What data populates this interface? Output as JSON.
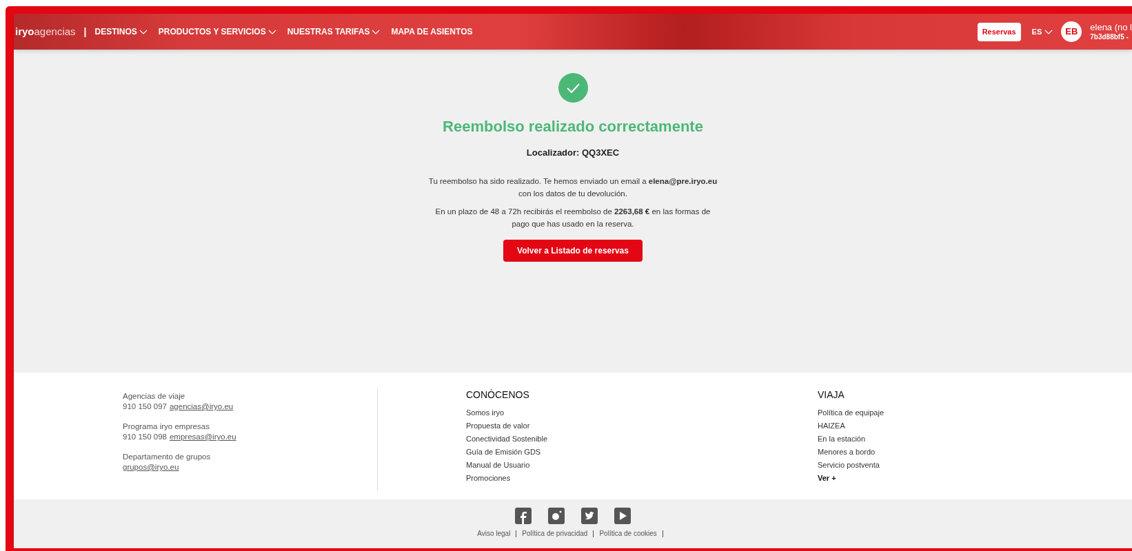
{
  "header": {
    "logo_bold": "iryo",
    "logo_light": "agencias",
    "separator": "|",
    "nav": [
      {
        "label": "DESTINOS",
        "dropdown": true
      },
      {
        "label": "PRODUCTOS Y SERVICIOS",
        "dropdown": true
      },
      {
        "label": "NUESTRAS TARIFAS",
        "dropdown": true
      },
      {
        "label": "MAPA DE ASIENTOS",
        "dropdown": false
      }
    ],
    "reservas_button": "Reservas",
    "language": "ES",
    "avatar_initials": "EB",
    "user_name": "elena (no l",
    "user_id": "7b3d88bf5 -"
  },
  "confirmation": {
    "title": "Reembolso realizado correctamente",
    "locator": "Localizador: QQ3XEC",
    "paragraphs": [
      "Tu reembolso ha sido realizado. Te hemos enviado un email a **elena@pre.iryo.eu** con los datos de tu devolución.",
      "En un plazo de 48 a 72h recibirás el reembolso de **2263,68 €** en las formas de pago que has usado en la reserva."
    ],
    "button": "Volver a Listado de reservas"
  },
  "footer": {
    "contacts": [
      {
        "label": "Agencias de viaje",
        "phone": "910 150 097",
        "email": "agencias@iryo.eu"
      },
      {
        "label": "Programa iryo empresas",
        "phone": "910 150 098",
        "email": "empresas@iryo.eu"
      },
      {
        "label": "Departamento de grupos",
        "email": "grupos@iryo.eu"
      }
    ],
    "columns": [
      {
        "title": "CONÓCENOS",
        "links": [
          {
            "label": "Somos iryo",
            "bold": false
          },
          {
            "label": "Propuesta de valor",
            "bold": false
          },
          {
            "label": "Conectividad Sostenible",
            "bold": false
          },
          {
            "label": "Guía de Emisión GDS",
            "bold": false
          },
          {
            "label": "Manual de Usuario",
            "bold": false
          },
          {
            "label": "Promociones",
            "bold": false
          }
        ]
      },
      {
        "title": "VIAJA",
        "links": [
          {
            "label": "Política de equipaje",
            "bold": false
          },
          {
            "label": "HAIZEA",
            "bold": false
          },
          {
            "label": "En la estación",
            "bold": false
          },
          {
            "label": "Menores a bordo",
            "bold": false
          },
          {
            "label": "Servicio postventa",
            "bold": false
          },
          {
            "label": "Ver +",
            "bold": true
          }
        ]
      }
    ],
    "social": [
      {
        "kind": "facebook"
      },
      {
        "kind": "instagram"
      },
      {
        "kind": "twitter"
      },
      {
        "kind": "youtube"
      }
    ],
    "legal": [
      "Aviso legal",
      "Política de privacidad",
      "Política de cookies"
    ]
  }
}
